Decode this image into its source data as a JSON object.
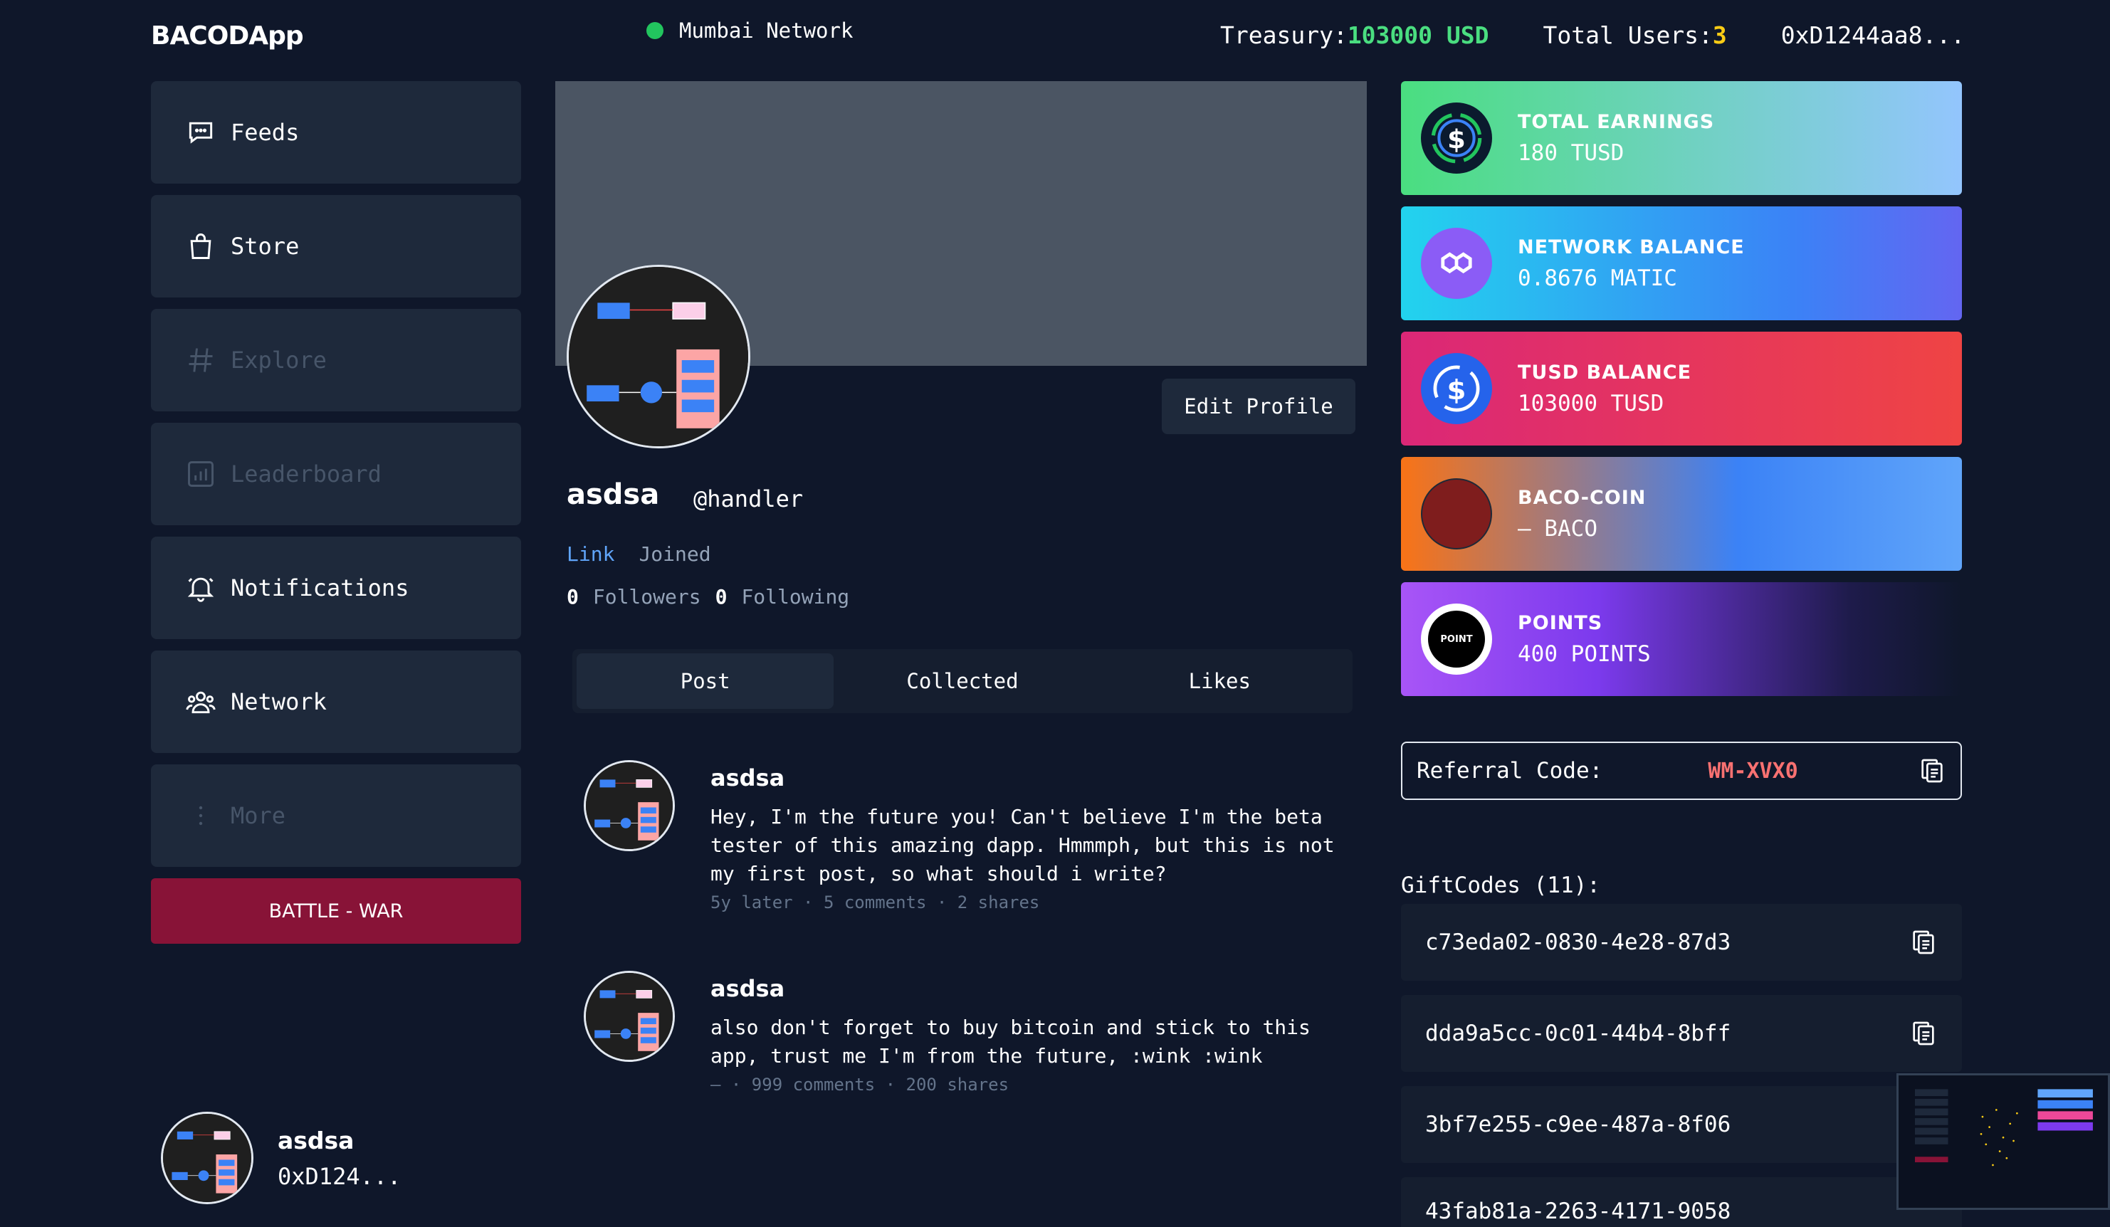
{
  "app": {
    "brand": "BACODApp",
    "network": "Mumbai Network",
    "treasury_label": "Treasury: ",
    "treasury_value": "103000 USD",
    "users_label": "Total Users: ",
    "users_value": "3",
    "wallet": "0xD1244aa8..."
  },
  "sidebar": {
    "items": [
      {
        "label": "Feeds",
        "icon": "chat-icon"
      },
      {
        "label": "Store",
        "icon": "shopping-bag-icon"
      },
      {
        "label": "Explore",
        "icon": "hash-icon"
      },
      {
        "label": "Leaderboard",
        "icon": "chart-icon"
      },
      {
        "label": "Notifications",
        "icon": "bell-icon"
      },
      {
        "label": "Network",
        "icon": "users-icon"
      },
      {
        "label": "More",
        "icon": "more-vertical-icon"
      }
    ],
    "battle": "BATTLE - WAR",
    "user_name": "asdsa",
    "user_addr": "0xD124..."
  },
  "profile": {
    "name": "asdsa",
    "handle": "@handler",
    "edit": "Edit Profile",
    "link": "Link",
    "joined": "Joined",
    "followers_count": "0",
    "followers_label": "Followers",
    "following_count": "0",
    "following_label": "Following"
  },
  "tabs": [
    "Post",
    "Collected",
    "Likes"
  ],
  "posts": [
    {
      "author": "asdsa",
      "text": "Hey, I'm the future you! Can't believe I'm the beta tester of this amazing dapp. Hmmmph, but this is not my first post, so what should i write?",
      "meta": "5y later · 5 comments · 2 shares"
    },
    {
      "author": "asdsa",
      "text": "also don't forget to buy bitcoin and stick to this app, trust me I'm from the future, :wink :wink",
      "meta": "– · 999 comments · 200 shares"
    }
  ],
  "cards": [
    {
      "title": "TOTAL EARNINGS",
      "value": "180 TUSD",
      "icon": "dollar-coin-icon"
    },
    {
      "title": "NETWORK BALANCE",
      "value": "0.8676 MATIC",
      "icon": "polygon-icon"
    },
    {
      "title": "TUSD BALANCE",
      "value": "103000 TUSD",
      "icon": "usd-coin-icon"
    },
    {
      "title": "BACO-COIN",
      "value": "– BACO",
      "icon": "baco-coin-icon"
    },
    {
      "title": "POINTS",
      "value": "400 POINTS",
      "icon": "point-icon"
    }
  ],
  "point_icon_text": "POINT",
  "referral": {
    "label": "Referral Code:",
    "code": "WM-XVX0"
  },
  "gifts_title": "GiftCodes (11):",
  "gifts": [
    "c73eda02-0830-4e28-87d3",
    "dda9a5cc-0c01-44b4-8bff",
    "3bf7e255-c9ee-487a-8f06",
    "43fab81a-2263-4171-9058"
  ],
  "colors": {
    "background": "#0f172a",
    "panel": "#1e293b",
    "battle": "#881337",
    "treasury": "#4ade80",
    "users": "#facc15",
    "referral_code": "#f87171",
    "link": "#60a5fa"
  }
}
